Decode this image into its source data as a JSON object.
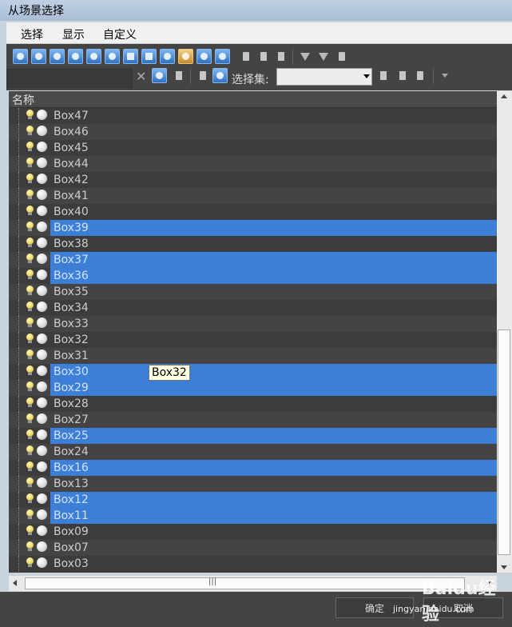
{
  "window": {
    "title": "从场景选择"
  },
  "menu": [
    "选择",
    "显示",
    "自定义"
  ],
  "toolbar": {
    "selection_set_label": "选择集:"
  },
  "column_header": "名称",
  "rows": [
    {
      "name": "Box47",
      "selected": false
    },
    {
      "name": "Box46",
      "selected": false
    },
    {
      "name": "Box45",
      "selected": false
    },
    {
      "name": "Box44",
      "selected": false
    },
    {
      "name": "Box42",
      "selected": false
    },
    {
      "name": "Box41",
      "selected": false
    },
    {
      "name": "Box40",
      "selected": false
    },
    {
      "name": "Box39",
      "selected": true
    },
    {
      "name": "Box38",
      "selected": false
    },
    {
      "name": "Box37",
      "selected": true
    },
    {
      "name": "Box36",
      "selected": true
    },
    {
      "name": "Box35",
      "selected": false
    },
    {
      "name": "Box34",
      "selected": false
    },
    {
      "name": "Box33",
      "selected": false
    },
    {
      "name": "Box32",
      "selected": false
    },
    {
      "name": "Box31",
      "selected": false
    },
    {
      "name": "Box30",
      "selected": true
    },
    {
      "name": "Box29",
      "selected": true
    },
    {
      "name": "Box28",
      "selected": false
    },
    {
      "name": "Box27",
      "selected": false
    },
    {
      "name": "Box25",
      "selected": true
    },
    {
      "name": "Box24",
      "selected": false
    },
    {
      "name": "Box16",
      "selected": true
    },
    {
      "name": "Box13",
      "selected": false
    },
    {
      "name": "Box12",
      "selected": true
    },
    {
      "name": "Box11",
      "selected": true
    },
    {
      "name": "Box09",
      "selected": false
    },
    {
      "name": "Box07",
      "selected": false
    },
    {
      "name": "Box03",
      "selected": false
    }
  ],
  "tooltip": "Box32",
  "buttons": {
    "ok": "确定",
    "cancel": "取消"
  },
  "watermark": {
    "text": "jingyan.baidu.com",
    "logo": "Baidu经验"
  },
  "colors": {
    "selection": "#3d7fd6",
    "list_bg": "#3c3c3c"
  }
}
